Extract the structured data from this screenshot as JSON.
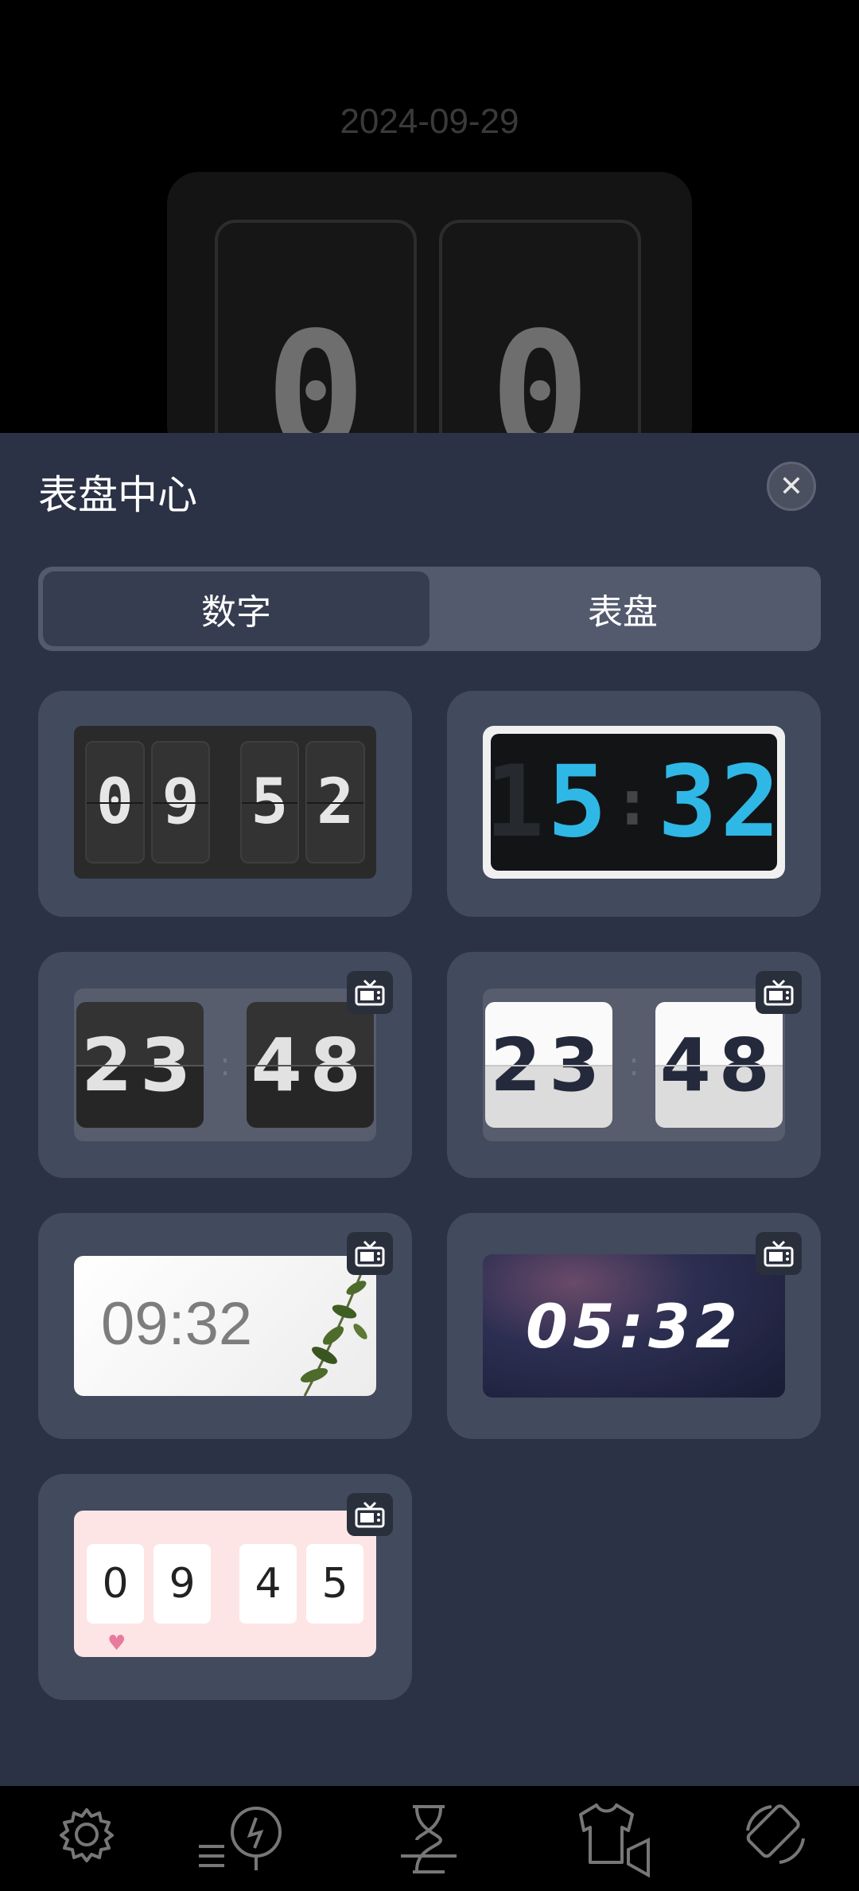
{
  "background": {
    "date": "2024-09-29",
    "digits": [
      "0",
      "0"
    ]
  },
  "sheet": {
    "title": "表盘中心",
    "close_symbol": "✕",
    "tabs": [
      {
        "label": "数字",
        "active": true
      },
      {
        "label": "表盘",
        "active": false
      }
    ]
  },
  "faces": {
    "flip_dark": {
      "digits": [
        "0",
        "9",
        "5",
        "2"
      ]
    },
    "lcd": {
      "ghost": "1",
      "lit_hour": "5",
      "colon": ":",
      "lit_min": "32"
    },
    "flip_big_dark": {
      "hour": "23",
      "min": "48",
      "sep": ":"
    },
    "flip_big_light": {
      "hour": "23",
      "min": "48",
      "sep": ":"
    },
    "plant": {
      "time": "09:32"
    },
    "galaxy": {
      "time": "05:32"
    },
    "pink": {
      "digits": [
        "0",
        "9",
        "4",
        "5"
      ],
      "heart": "♥"
    }
  },
  "nav": {
    "items": [
      {
        "icon": "gear-icon"
      },
      {
        "icon": "clock-stopwatch-icon"
      },
      {
        "icon": "hourglass-icon"
      },
      {
        "icon": "shirt-icon"
      },
      {
        "icon": "rotate-screen-icon"
      }
    ]
  },
  "colors": {
    "sheet_bg": "#2c3245",
    "card_bg": "#424a5e",
    "lcd_accent": "#2fb8e6"
  }
}
